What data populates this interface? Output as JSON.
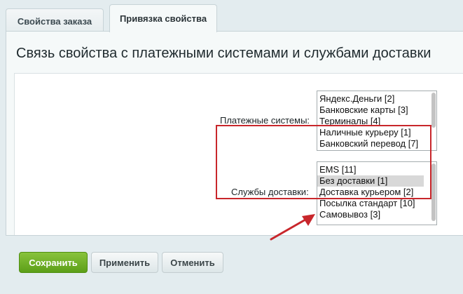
{
  "tabs": [
    {
      "label": "Свойства заказа",
      "active": false
    },
    {
      "label": "Привязка свойства",
      "active": true
    }
  ],
  "section": {
    "title": "Связь свойства с платежными системами и службами доставки"
  },
  "payment": {
    "label": "Платежные системы:",
    "options": [
      "Яндекс.Деньги [2]",
      "Банковские карты [3]",
      "Терминалы [4]",
      "Наличные курьеру [1]",
      "Банковский перевод [7]"
    ]
  },
  "delivery": {
    "label": "Службы доставки:",
    "options": [
      "EMS [11]",
      "Без доставки [1]",
      "Доставка курьером [2]",
      "Посылка стандарт [10]",
      "Самовывоз [3]"
    ],
    "selected": "Без доставки [1]"
  },
  "buttons": {
    "save": "Сохранить",
    "apply": "Применить",
    "cancel": "Отменить"
  },
  "colors": {
    "highlight": "#c8262b",
    "save_button": "#6aae22"
  }
}
